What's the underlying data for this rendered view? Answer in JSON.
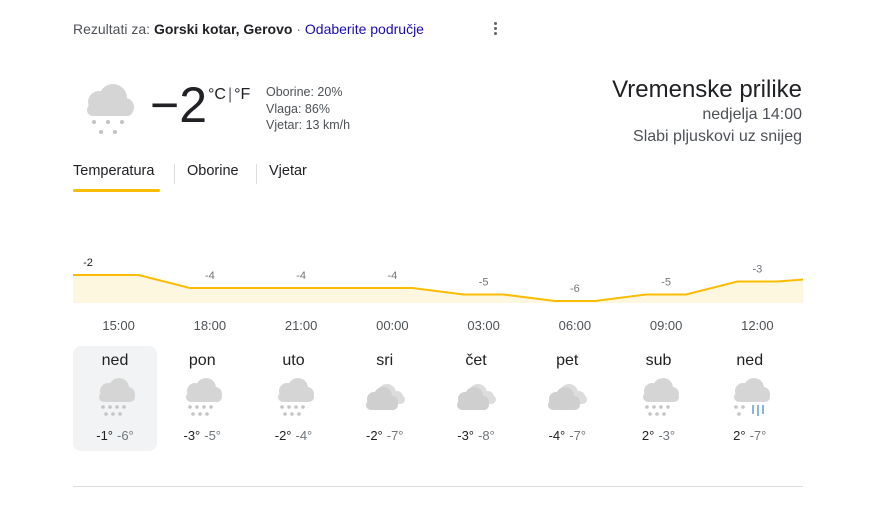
{
  "header": {
    "prefix": "Rezultati za:",
    "location": "Gorski kotar, Gerovo",
    "separator": "·",
    "change_area": "Odaberite područje",
    "menu_icon": "more-vert-icon"
  },
  "current": {
    "icon": "cloud-snow-icon",
    "temperature": "−2",
    "unit_c": "°C",
    "unit_sep": "|",
    "unit_f": "°F",
    "precipitation": "Oborine: 20%",
    "humidity": "Vlaga: 86%",
    "wind": "Vjetar: 13 km/h"
  },
  "summary": {
    "title": "Vremenske prilike",
    "datetime": "nedjelja 14:00",
    "condition": "Slabi pljuskovi uz snijeg"
  },
  "tabs": [
    "Temperatura",
    "Oborine",
    "Vjetar"
  ],
  "active_tab": "Temperatura",
  "chart_data": {
    "type": "area",
    "x": [
      "15:00",
      "18:00",
      "21:00",
      "00:00",
      "03:00",
      "06:00",
      "09:00",
      "12:00"
    ],
    "values": [
      -2,
      -4,
      -4,
      -4,
      -5,
      -6,
      -5,
      -3
    ],
    "labels": [
      "-2",
      "-4",
      "-4",
      "-4",
      "-5",
      "-6",
      "-5",
      "-3"
    ],
    "line_color": "#fbbc04",
    "fill_color": "#fef7e0"
  },
  "days": [
    {
      "name": "ned",
      "high": "-1°",
      "low": "-6°",
      "icon": "cloud-snow-icon",
      "selected": true
    },
    {
      "name": "pon",
      "high": "-3°",
      "low": "-5°",
      "icon": "cloud-snow-icon"
    },
    {
      "name": "uto",
      "high": "-2°",
      "low": "-4°",
      "icon": "cloud-snow-icon"
    },
    {
      "name": "sri",
      "high": "-2°",
      "low": "-7°",
      "icon": "cloudy-icon"
    },
    {
      "name": "čet",
      "high": "-3°",
      "low": "-8°",
      "icon": "cloudy-icon"
    },
    {
      "name": "pet",
      "high": "-4°",
      "low": "-7°",
      "icon": "cloudy-icon"
    },
    {
      "name": "sub",
      "high": "2°",
      "low": "-3°",
      "icon": "cloud-snow-icon"
    },
    {
      "name": "ned",
      "high": "2°",
      "low": "-7°",
      "icon": "rain-snow-icon"
    }
  ]
}
